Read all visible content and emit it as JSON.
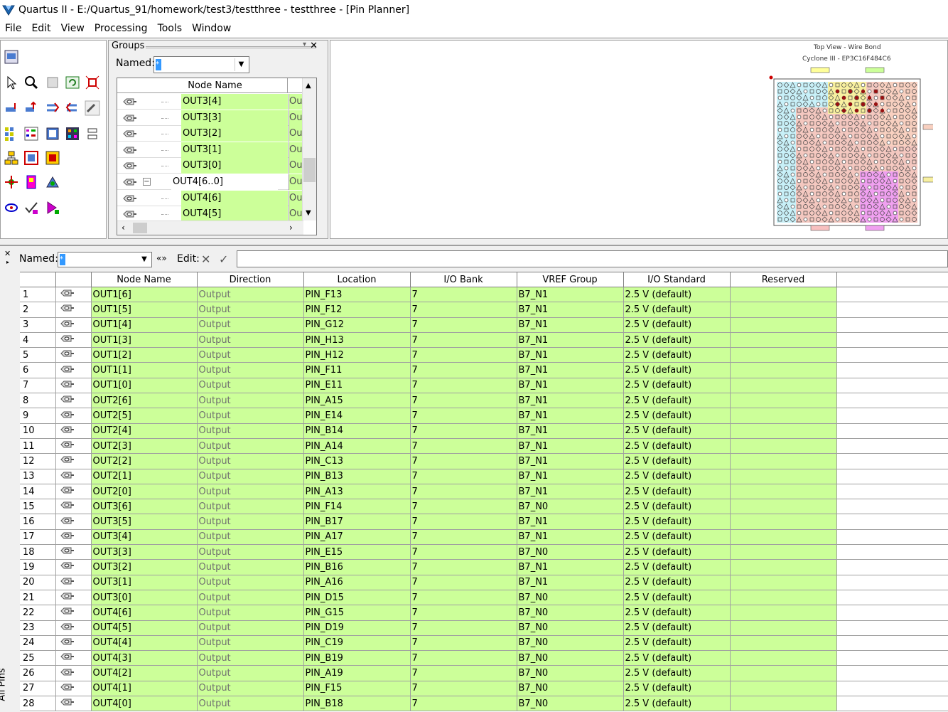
{
  "window": {
    "title": "Quartus II - E:/Quartus_91/homework/test3/testthree - testthree - [Pin Planner]"
  },
  "menu": [
    "File",
    "Edit",
    "View",
    "Processing",
    "Tools",
    "Window"
  ],
  "groups": {
    "title": "Groups",
    "named_label": "Named:",
    "named_value": "*",
    "column": "Node Name",
    "rows": [
      {
        "name": "OUT3[4]",
        "dir": "Ou",
        "child": true
      },
      {
        "name": "OUT3[3]",
        "dir": "Ou",
        "child": true
      },
      {
        "name": "OUT3[2]",
        "dir": "Ou",
        "child": true
      },
      {
        "name": "OUT3[1]",
        "dir": "Ou",
        "child": true
      },
      {
        "name": "OUT3[0]",
        "dir": "Ou",
        "child": true
      },
      {
        "name": "OUT4[6..0]",
        "dir": "Ou",
        "child": false
      },
      {
        "name": "OUT4[6]",
        "dir": "Ou",
        "child": true
      },
      {
        "name": "OUT4[5]",
        "dir": "Ou",
        "child": true
      }
    ]
  },
  "chip": {
    "view_label": "Top View - Wire Bond",
    "device_label": "Cyclone III - EP3C16F484C6"
  },
  "filter": {
    "named_label": "Named:",
    "named_value": "*",
    "edit_label": "Edit:",
    "expand_label": "«»"
  },
  "side_tab": "All Pins",
  "table": {
    "columns": [
      "",
      "",
      "Node Name",
      "Direction",
      "Location",
      "I/O Bank",
      "VREF Group",
      "I/O Standard",
      "Reserved"
    ],
    "rows": [
      [
        "1",
        "OUT1[6]",
        "Output",
        "PIN_F13",
        "7",
        "B7_N1",
        "2.5 V (default)"
      ],
      [
        "2",
        "OUT1[5]",
        "Output",
        "PIN_F12",
        "7",
        "B7_N1",
        "2.5 V (default)"
      ],
      [
        "3",
        "OUT1[4]",
        "Output",
        "PIN_G12",
        "7",
        "B7_N1",
        "2.5 V (default)"
      ],
      [
        "4",
        "OUT1[3]",
        "Output",
        "PIN_H13",
        "7",
        "B7_N1",
        "2.5 V (default)"
      ],
      [
        "5",
        "OUT1[2]",
        "Output",
        "PIN_H12",
        "7",
        "B7_N1",
        "2.5 V (default)"
      ],
      [
        "6",
        "OUT1[1]",
        "Output",
        "PIN_F11",
        "7",
        "B7_N1",
        "2.5 V (default)"
      ],
      [
        "7",
        "OUT1[0]",
        "Output",
        "PIN_E11",
        "7",
        "B7_N1",
        "2.5 V (default)"
      ],
      [
        "8",
        "OUT2[6]",
        "Output",
        "PIN_A15",
        "7",
        "B7_N1",
        "2.5 V (default)"
      ],
      [
        "9",
        "OUT2[5]",
        "Output",
        "PIN_E14",
        "7",
        "B7_N1",
        "2.5 V (default)"
      ],
      [
        "10",
        "OUT2[4]",
        "Output",
        "PIN_B14",
        "7",
        "B7_N1",
        "2.5 V (default)"
      ],
      [
        "11",
        "OUT2[3]",
        "Output",
        "PIN_A14",
        "7",
        "B7_N1",
        "2.5 V (default)"
      ],
      [
        "12",
        "OUT2[2]",
        "Output",
        "PIN_C13",
        "7",
        "B7_N1",
        "2.5 V (default)"
      ],
      [
        "13",
        "OUT2[1]",
        "Output",
        "PIN_B13",
        "7",
        "B7_N1",
        "2.5 V (default)"
      ],
      [
        "14",
        "OUT2[0]",
        "Output",
        "PIN_A13",
        "7",
        "B7_N1",
        "2.5 V (default)"
      ],
      [
        "15",
        "OUT3[6]",
        "Output",
        "PIN_F14",
        "7",
        "B7_N0",
        "2.5 V (default)"
      ],
      [
        "16",
        "OUT3[5]",
        "Output",
        "PIN_B17",
        "7",
        "B7_N1",
        "2.5 V (default)"
      ],
      [
        "17",
        "OUT3[4]",
        "Output",
        "PIN_A17",
        "7",
        "B7_N1",
        "2.5 V (default)"
      ],
      [
        "18",
        "OUT3[3]",
        "Output",
        "PIN_E15",
        "7",
        "B7_N0",
        "2.5 V (default)"
      ],
      [
        "19",
        "OUT3[2]",
        "Output",
        "PIN_B16",
        "7",
        "B7_N1",
        "2.5 V (default)"
      ],
      [
        "20",
        "OUT3[1]",
        "Output",
        "PIN_A16",
        "7",
        "B7_N1",
        "2.5 V (default)"
      ],
      [
        "21",
        "OUT3[0]",
        "Output",
        "PIN_D15",
        "7",
        "B7_N0",
        "2.5 V (default)"
      ],
      [
        "22",
        "OUT4[6]",
        "Output",
        "PIN_G15",
        "7",
        "B7_N0",
        "2.5 V (default)"
      ],
      [
        "23",
        "OUT4[5]",
        "Output",
        "PIN_D19",
        "7",
        "B7_N0",
        "2.5 V (default)"
      ],
      [
        "24",
        "OUT4[4]",
        "Output",
        "PIN_C19",
        "7",
        "B7_N0",
        "2.5 V (default)"
      ],
      [
        "25",
        "OUT4[3]",
        "Output",
        "PIN_B19",
        "7",
        "B7_N0",
        "2.5 V (default)"
      ],
      [
        "26",
        "OUT4[2]",
        "Output",
        "PIN_A19",
        "7",
        "B7_N0",
        "2.5 V (default)"
      ],
      [
        "27",
        "OUT4[1]",
        "Output",
        "PIN_F15",
        "7",
        "B7_N0",
        "2.5 V (default)"
      ],
      [
        "28",
        "OUT4[0]",
        "Output",
        "PIN_B18",
        "7",
        "B7_N0",
        "2.5 V (default)"
      ]
    ]
  },
  "colors": {
    "assigned_cell": "#ccff99",
    "selection": "#3399ff"
  }
}
